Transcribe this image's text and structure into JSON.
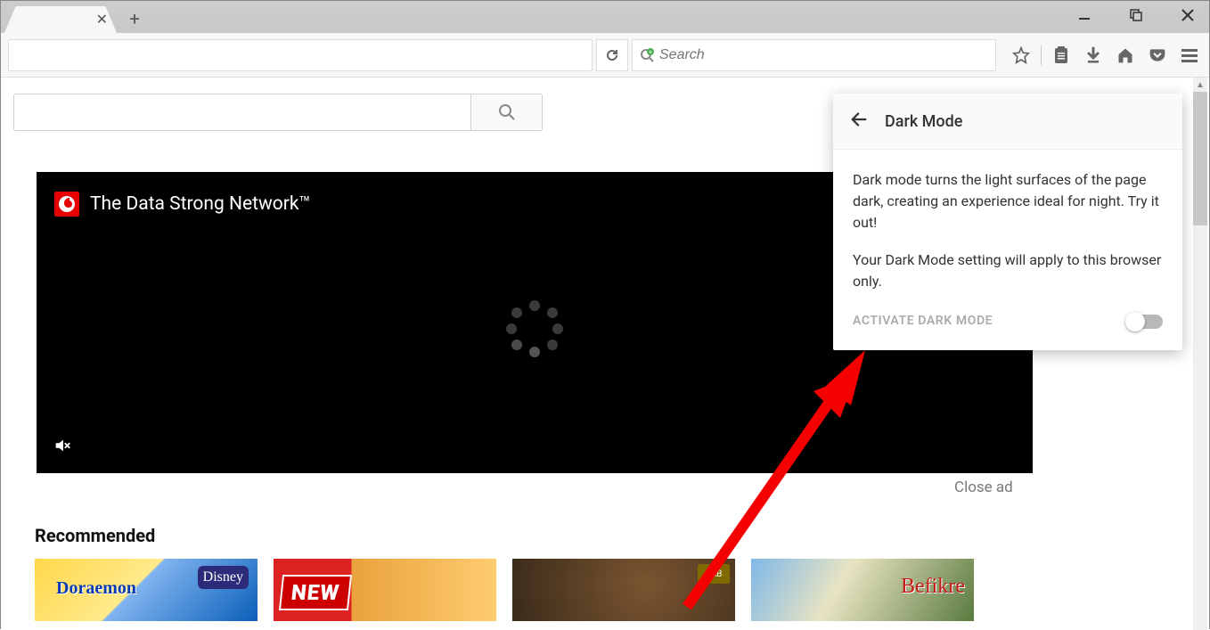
{
  "browser": {
    "search_placeholder": "Search"
  },
  "video": {
    "title": "The Data Strong Network™"
  },
  "close_ad": "Close ad",
  "recommended_label": "Recommended",
  "thumbs": {
    "t1_disney": "Disney",
    "t2_new": "NEW",
    "t3_sab": "SAB"
  },
  "popup": {
    "title": "Dark Mode",
    "desc1": "Dark mode turns the light surfaces of the page dark, creating an experience ideal for night. Try it out!",
    "desc2": "Your Dark Mode setting will apply to this browser only.",
    "activate": "ACTIVATE DARK MODE"
  }
}
